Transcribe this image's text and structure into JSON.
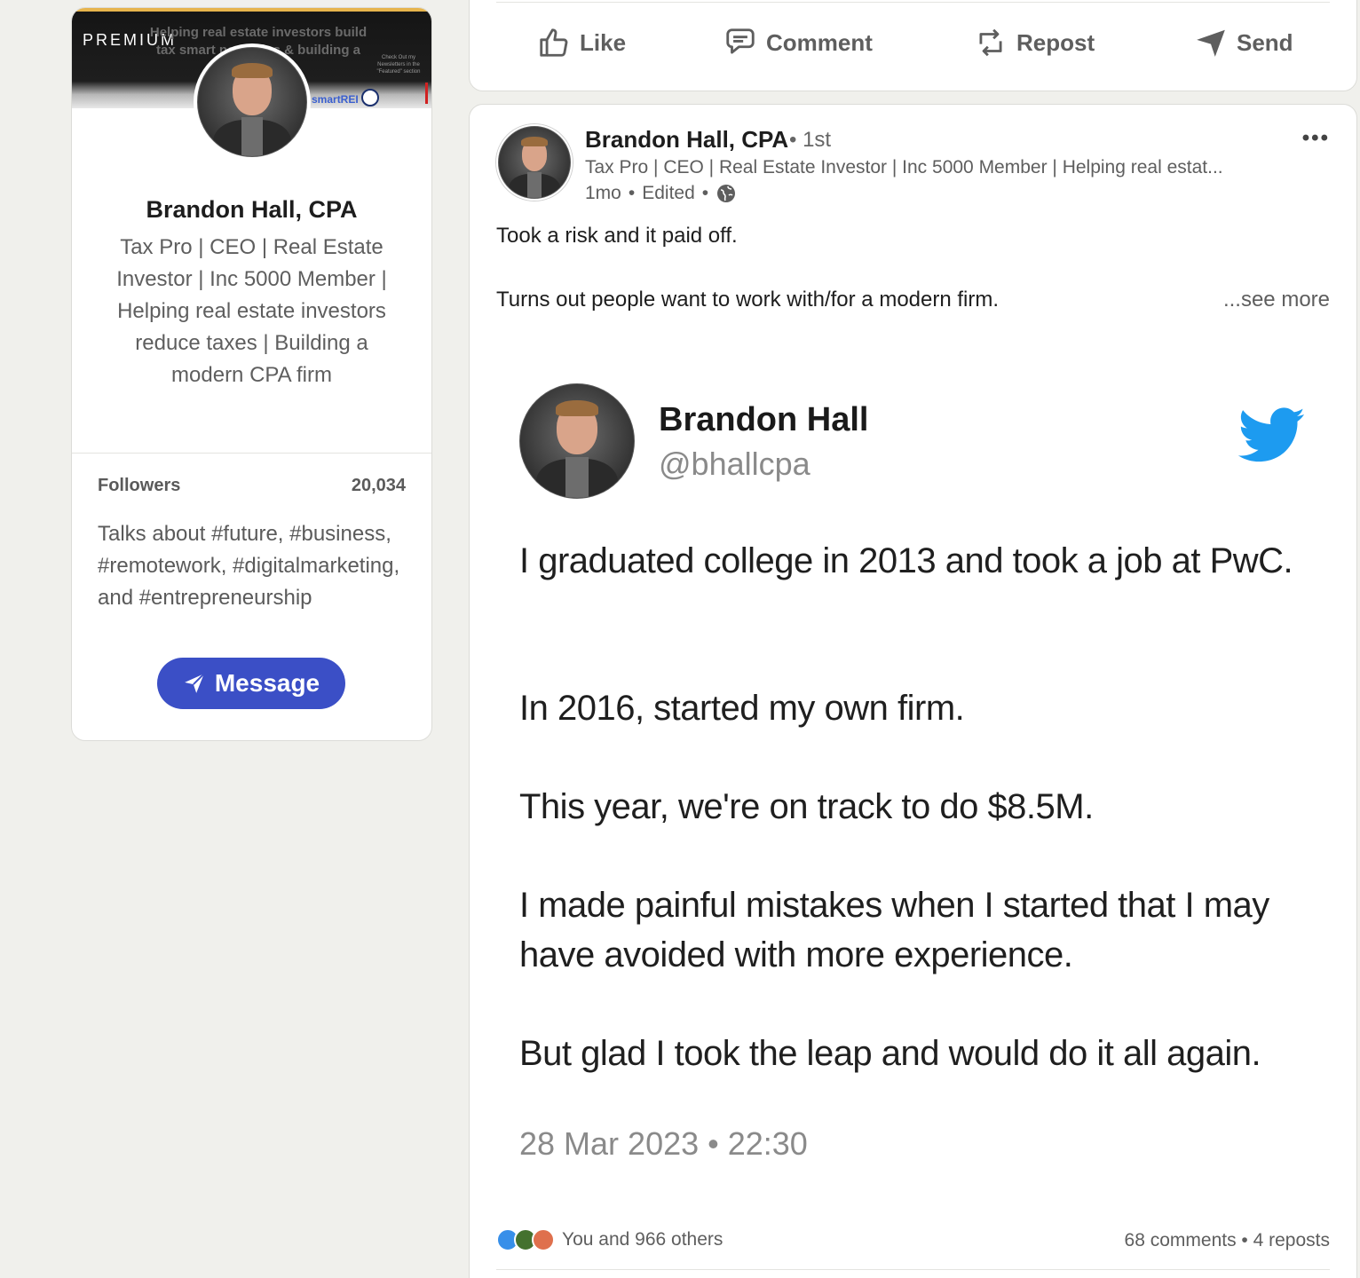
{
  "profile": {
    "premium_label": "PREMIUM",
    "banner_text": "Helping real estate investors build tax smart portfolios & building a modern firm",
    "banner_note": "Check Out my Newsletters in the \"Featured\" section",
    "banner_brand": "smartREI",
    "name": "Brandon Hall, CPA",
    "headline": "Tax Pro | CEO | Real Estate Investor | Inc 5000 Member | Helping real estate investors reduce taxes | Building a modern CPA firm",
    "followers_label": "Followers",
    "followers_count": "20,034",
    "talks_about": "Talks about #future, #business, #remotework, #digitalmarketing, and #entrepreneurship",
    "message_label": "Message"
  },
  "actions": {
    "like": "Like",
    "comment": "Comment",
    "repost": "Repost",
    "send": "Send"
  },
  "post": {
    "author": "Brandon Hall, CPA",
    "degree": "• 1st",
    "headline": "Tax Pro | CEO | Real Estate Investor | Inc 5000 Member | Helping real estat...",
    "time": "1mo",
    "dot1": "•",
    "edited": "Edited",
    "dot2": "•",
    "more": "•••",
    "text_line1": "Took a risk and it paid off.",
    "text_line2": "Turns out people want to work with/for a modern firm.",
    "see_more": "...see more",
    "tweet": {
      "name": "Brandon Hall",
      "handle": "@bhallcpa",
      "line1": "I graduated college in 2013 and took a job at PwC.",
      "line2": "In 2016, started my own firm.",
      "line3": "This year, we're on track to do $8.5M.",
      "line4": "I made painful mistakes when I started that I may have avoided with more experience.",
      "line5": "But glad I took the leap and would do it all again.",
      "timestamp": "28 Mar 2023 • 22:30"
    },
    "reactions_text": "You and 966 others",
    "stats": "68 comments • 4 reposts"
  },
  "colors": {
    "accent": "#3b4fc6",
    "twitter_blue": "#1d9bf0",
    "premium_gold": "#e6b44c"
  }
}
